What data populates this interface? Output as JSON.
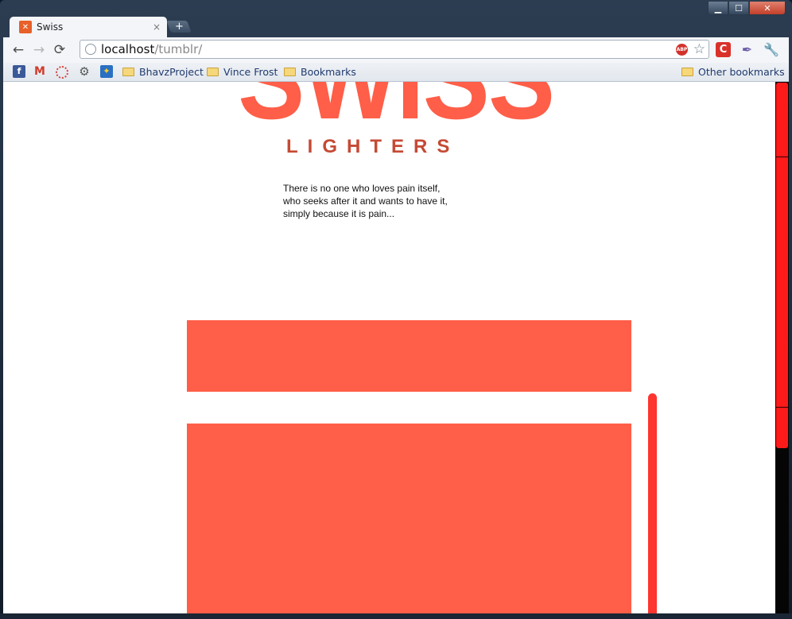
{
  "browser": {
    "tab_title": "Swiss",
    "tab_close": "×",
    "new_tab": "+",
    "url_host": "localhost",
    "url_path": "/tumblr/",
    "abp_label": "ABP",
    "star": "☆",
    "window_controls": {
      "minimize": "▁",
      "maximize": "☐",
      "close": "✕"
    }
  },
  "toolbar": {
    "back": "←",
    "forward": "→",
    "reload": "⟳"
  },
  "bookmarks": {
    "icons": [
      "facebook-icon",
      "gmail-icon",
      "ring-icon",
      "gear-icon",
      "puzzle-icon"
    ],
    "folders": [
      {
        "label": "BhavzProject"
      },
      {
        "label": "Vince Frost"
      },
      {
        "label": "Bookmarks"
      }
    ],
    "other": "Other bookmarks"
  },
  "page": {
    "logo_main": "SWISS",
    "logo_sub": "LIGHTERS",
    "intro": "There is no one who loves pain itself, who seeks after it and wants to have it, simply because it is pain...",
    "accent": "#ff5e48"
  }
}
